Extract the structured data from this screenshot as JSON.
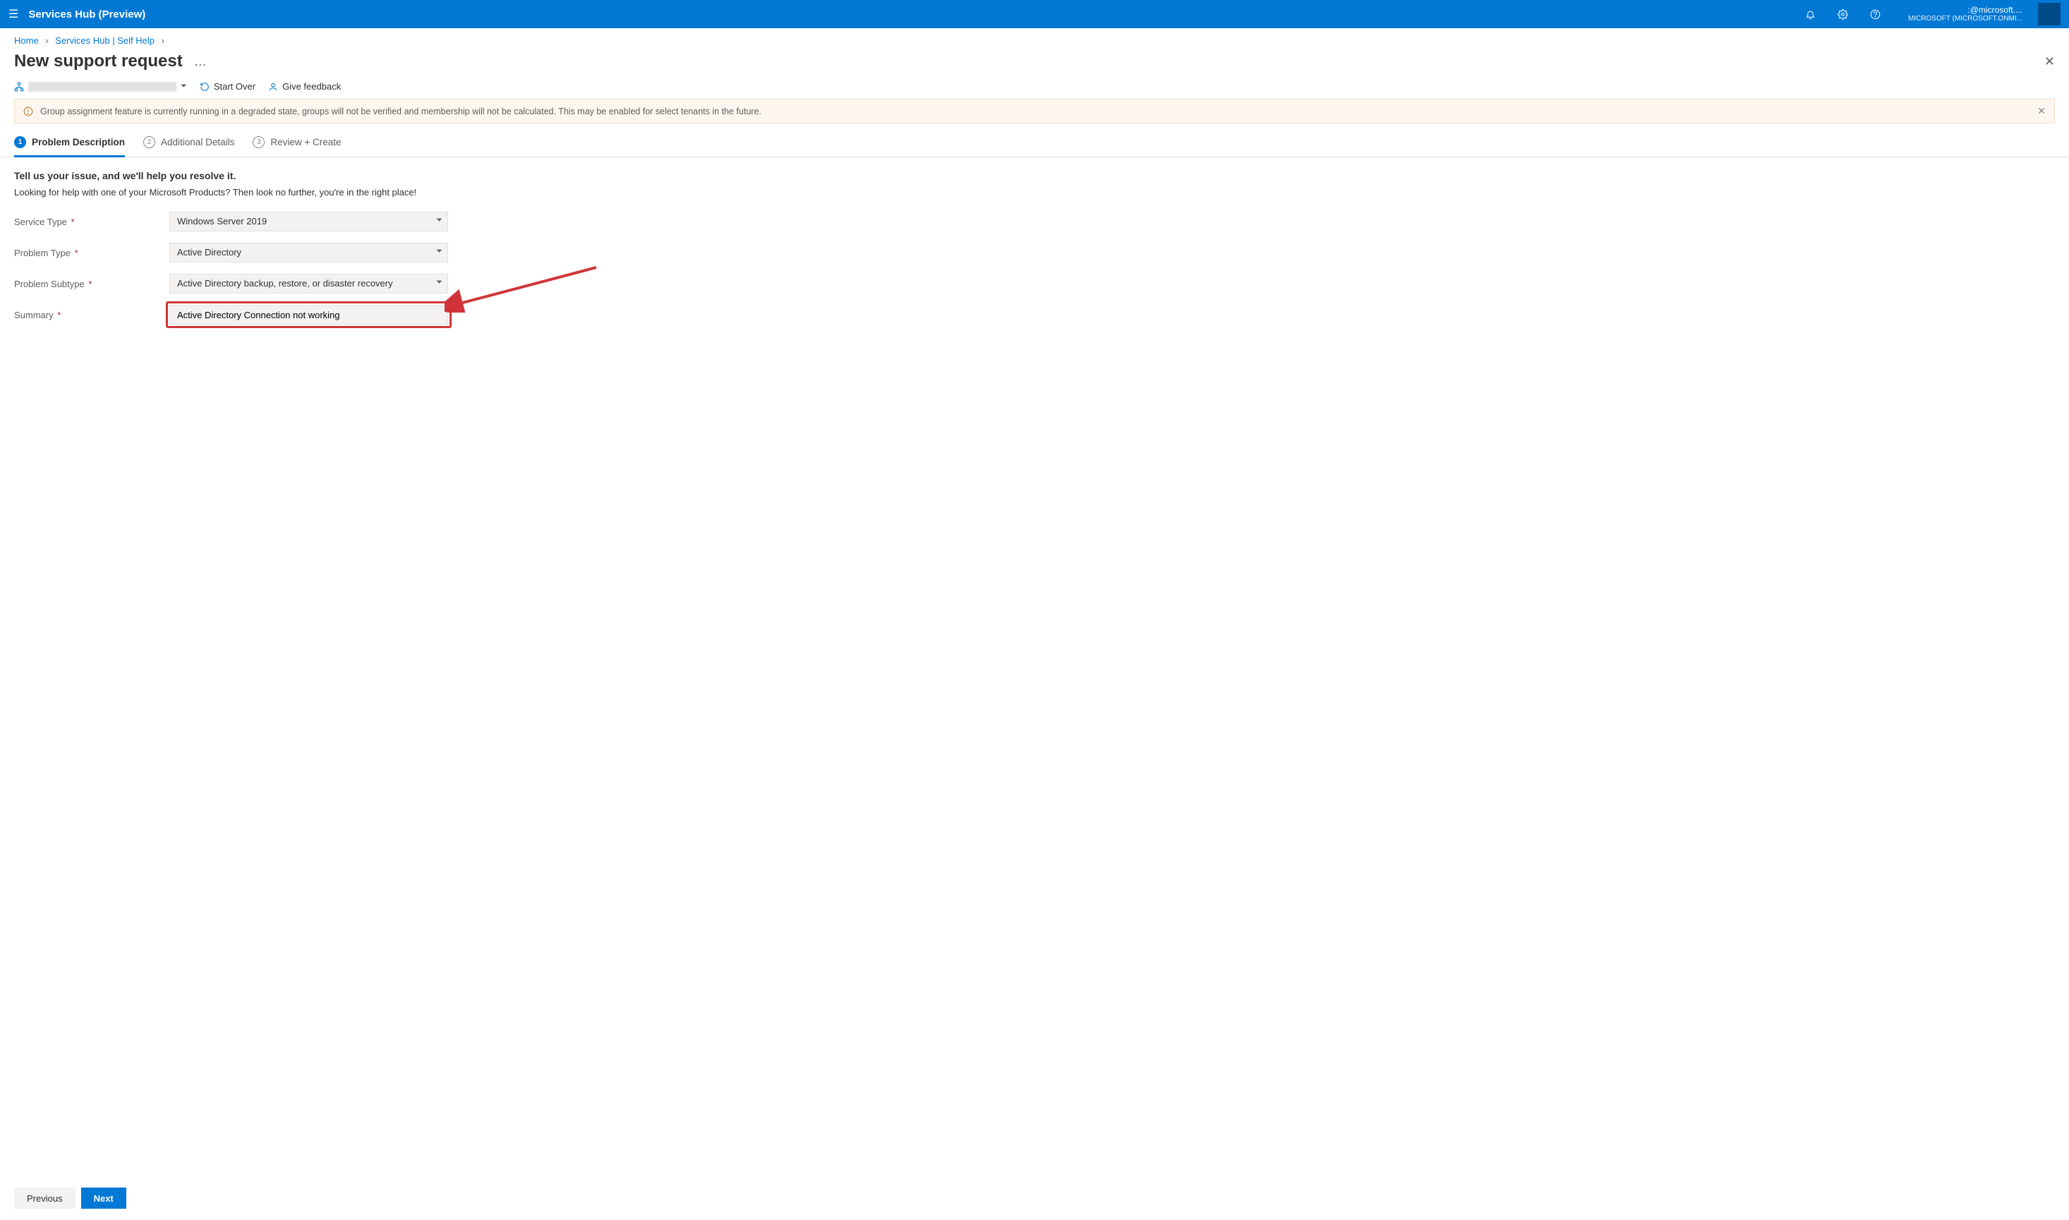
{
  "topbar": {
    "title": "Services Hub (Preview)",
    "account_line1": ":@microsoft....",
    "account_line2": "MICROSOFT (MICROSOFT.ONMI..."
  },
  "breadcrumb": {
    "items": [
      "Home",
      "Services Hub | Self Help"
    ]
  },
  "page": {
    "title": "New support request",
    "more": "…"
  },
  "toolbar": {
    "start_over": "Start Over",
    "feedback": "Give feedback"
  },
  "banner": {
    "text": "Group assignment feature is currently running in a degraded state, groups will not be verified and membership will not be calculated. This may be enabled for select tenants in the future."
  },
  "tabs": [
    {
      "num": "1",
      "label": "Problem Description"
    },
    {
      "num": "2",
      "label": "Additional Details"
    },
    {
      "num": "3",
      "label": "Review + Create"
    }
  ],
  "form": {
    "heading": "Tell us your issue, and we'll help you resolve it.",
    "subtext": "Looking for help with one of your Microsoft Products? Then look no further, you're in the right place!",
    "fields": {
      "service_type": {
        "label": "Service Type",
        "value": "Windows Server 2019"
      },
      "problem_type": {
        "label": "Problem Type",
        "value": "Active Directory"
      },
      "problem_subtype": {
        "label": "Problem Subtype",
        "value": "Active Directory backup, restore, or disaster recovery"
      },
      "summary": {
        "label": "Summary",
        "value": "Active Directory Connection not working"
      }
    }
  },
  "footer": {
    "prev": "Previous",
    "next": "Next"
  }
}
